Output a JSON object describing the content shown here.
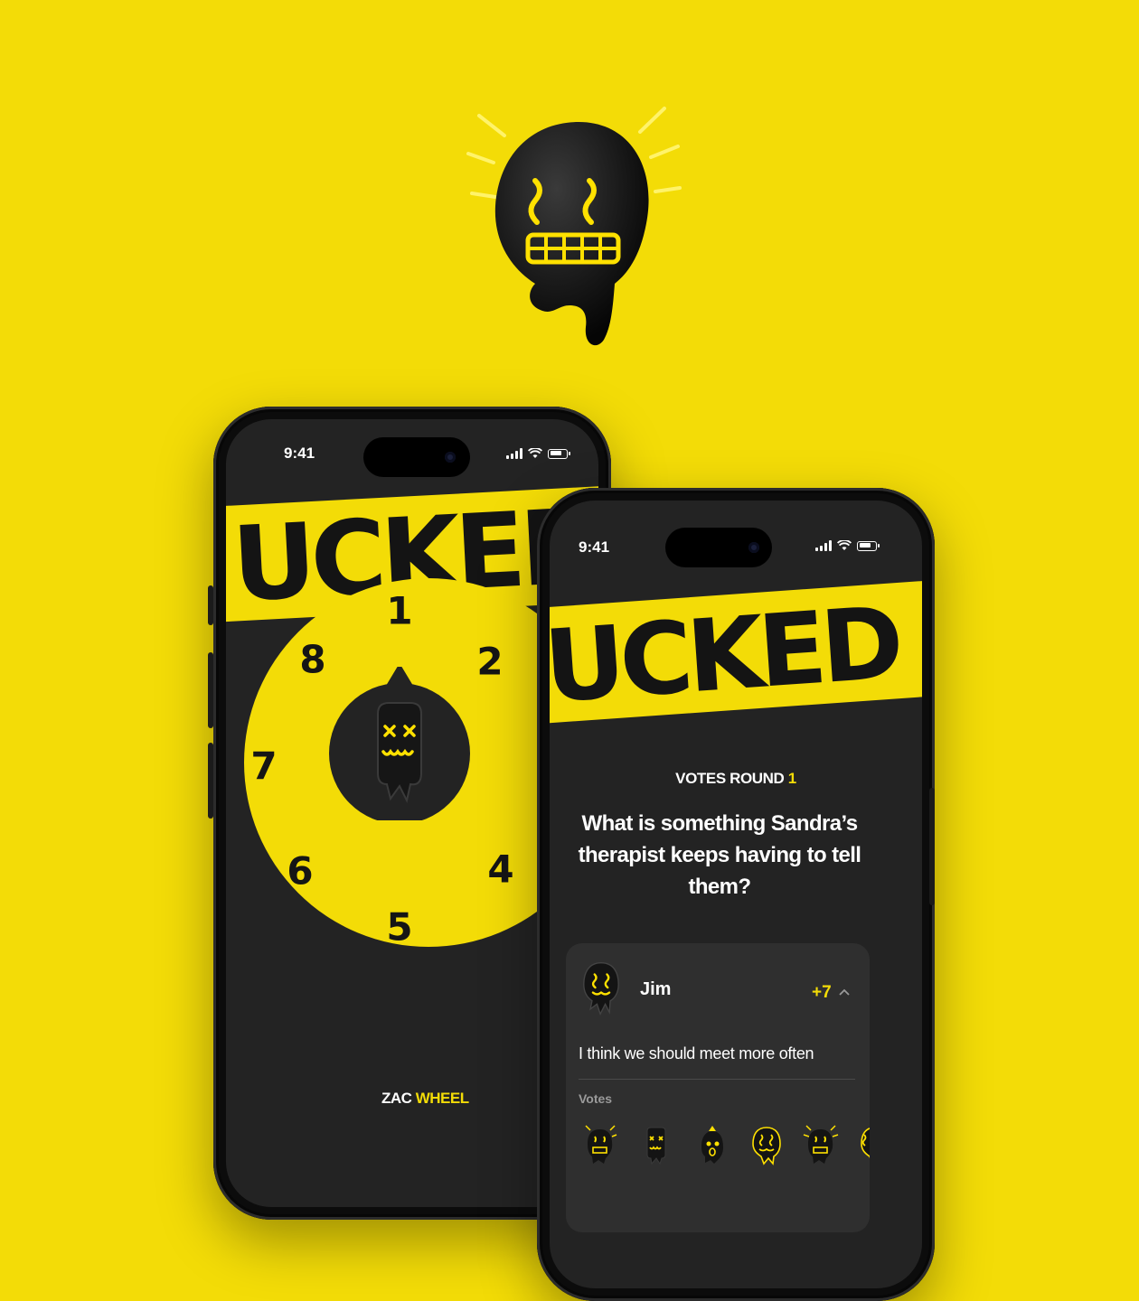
{
  "colors": {
    "accent": "#f3dc07",
    "screen": "#232323",
    "card": "#2f2f2f",
    "ink": "#141414"
  },
  "mascot": {
    "icon": "drip-ghost-mascot-icon"
  },
  "phone_left": {
    "status": {
      "time": "9:41"
    },
    "banner": "UCKED",
    "wheel": {
      "numbers": [
        "1",
        "2",
        "4",
        "5",
        "6",
        "7",
        "8"
      ]
    },
    "footer": {
      "first": "ZAC",
      "second": "WHEEL"
    }
  },
  "phone_right": {
    "status": {
      "time": "9:41"
    },
    "banner": "UCKED",
    "round": {
      "label": "VOTES ROUND",
      "number": "1"
    },
    "question": "What is something Sandra’s therapist keeps having to tell them?",
    "answer_card": {
      "player": "Jim",
      "points": "+7",
      "answer": "I think we should meet more often",
      "votes_label": "Votes",
      "voters": [
        "shock-ghost-icon",
        "dizzy-ghost-icon",
        "sleepy-ghost-icon",
        "swirl-ghost-icon",
        "shock-ghost-icon",
        "swirl-ghost-icon"
      ]
    }
  }
}
